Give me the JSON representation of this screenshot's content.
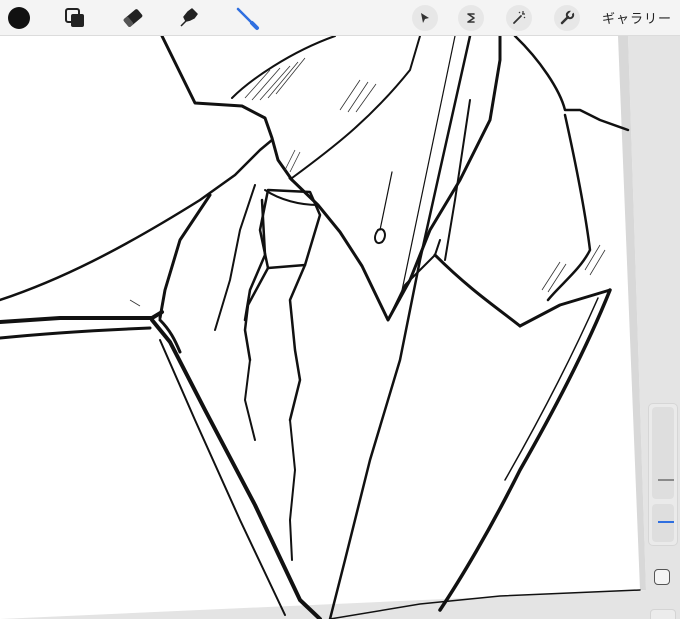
{
  "toolbar": {
    "gallery_label": "ギャラリー",
    "tools": [
      {
        "name": "color-swatch",
        "icon": "filled-circle-icon",
        "color": "#111111"
      },
      {
        "name": "layers",
        "icon": "layers-icon"
      },
      {
        "name": "eraser",
        "icon": "eraser-icon"
      },
      {
        "name": "smudge",
        "icon": "smudge-icon"
      },
      {
        "name": "brush",
        "icon": "brush-icon",
        "color": "#2f6fe0",
        "active": true
      }
    ],
    "actions": [
      {
        "name": "transform",
        "icon": "cursor-arrow-icon"
      },
      {
        "name": "selection",
        "icon": "selection-s-icon"
      },
      {
        "name": "adjustments",
        "icon": "magic-wand-icon"
      },
      {
        "name": "actions",
        "icon": "wrench-icon"
      }
    ]
  },
  "sidebar": {
    "brush_size": 0.18,
    "opacity": 0.5,
    "accent_color": "#2f6fe0"
  },
  "canvas": {
    "background": "#ffffff",
    "line_color": "#111111",
    "surround_color": "#e4e4e4"
  }
}
